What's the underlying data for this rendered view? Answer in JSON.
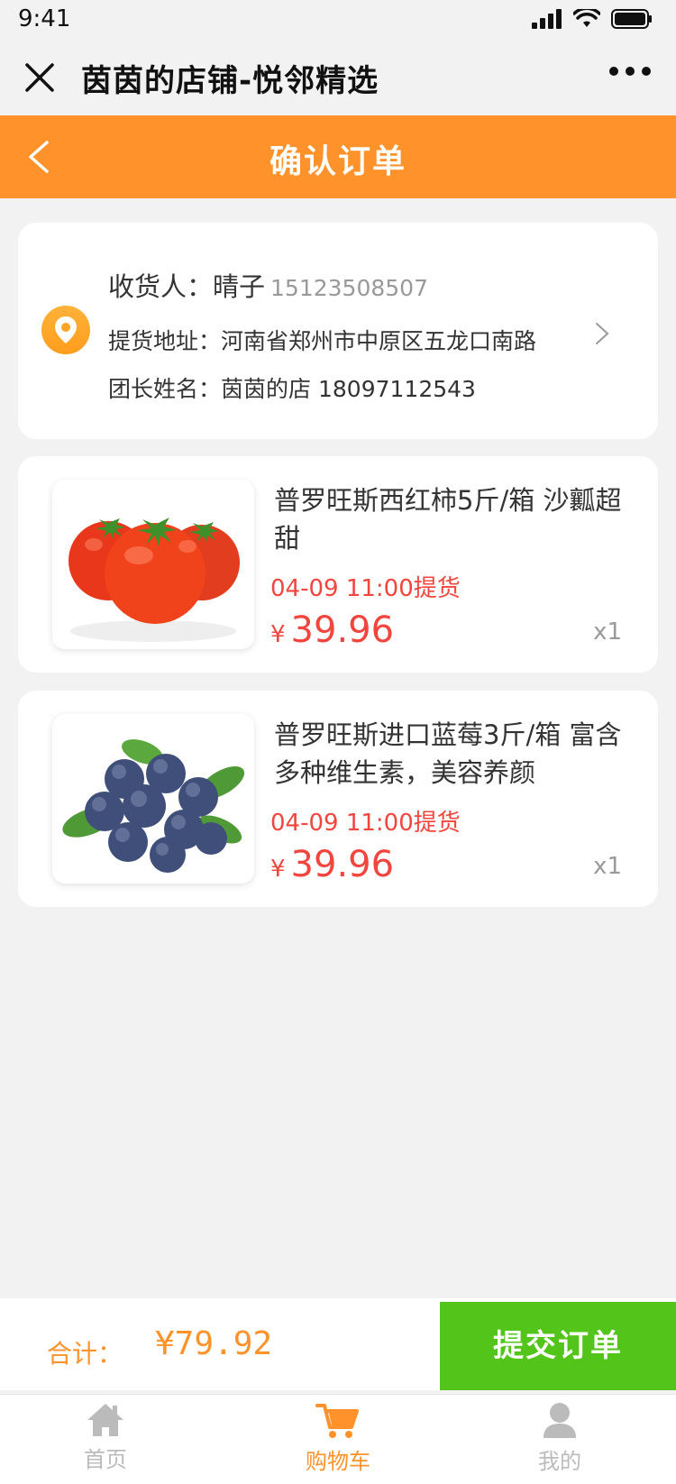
{
  "status": {
    "time": "9:41"
  },
  "wechat": {
    "title": "茵茵的店铺-悦邻精选"
  },
  "header": {
    "title": "确认订单"
  },
  "address": {
    "receiver_label": "收货人：",
    "receiver_name": "晴子",
    "receiver_phone": "15123508507",
    "pickup_label": "提货地址：",
    "pickup_address": "河南省郑州市中原区五龙口南路",
    "leader_label": "团长姓名：",
    "leader_name": "茵茵的店",
    "leader_phone": "18097112543"
  },
  "products": [
    {
      "name": "普罗旺斯西红柿5斤/箱 沙瓤超甜",
      "pickup_time": "04-09 11:00提货",
      "currency": "¥",
      "price": "39.96",
      "qty": "x1",
      "image_icon": "tomato-image"
    },
    {
      "name": "普罗旺斯进口蓝莓3斤/箱 富含多种维生素，美容养颜",
      "pickup_time": "04-09 11:00提货",
      "currency": "¥",
      "price": "39.96",
      "qty": "x1",
      "image_icon": "blueberry-image"
    }
  ],
  "summary": {
    "total_label": "合计：",
    "total_amount": "¥79.92",
    "submit_label": "提交订单"
  },
  "tabs": [
    {
      "label": "首页",
      "icon": "home-icon"
    },
    {
      "label": "购物车",
      "icon": "cart-icon",
      "active": true
    },
    {
      "label": "我的",
      "icon": "user-icon"
    }
  ],
  "colors": {
    "brand_orange": "#ff922b",
    "price_red": "#f2453d",
    "submit_green": "#52c41a",
    "background": "#f2f2f2"
  }
}
